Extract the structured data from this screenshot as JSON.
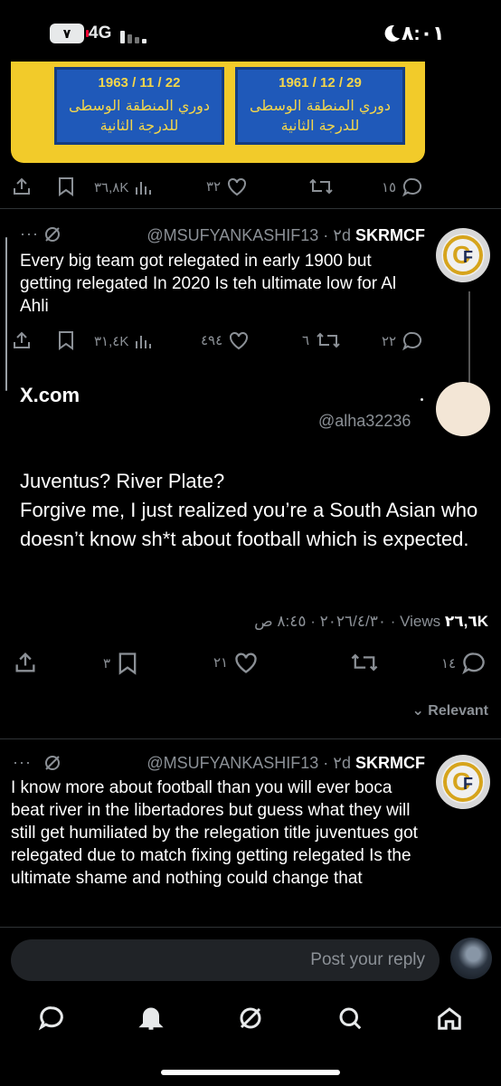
{
  "status": {
    "battery": "٧",
    "network": "4G",
    "time": "٨:٠١"
  },
  "media": {
    "plaques": [
      {
        "date": "1963 / 11 / 22",
        "line1": "دوري المنطقة الوسطى",
        "line2": "للدرجة الثانية"
      },
      {
        "date": "1961 / 12 / 29",
        "line1": "دوري المنطقة الوسطى",
        "line2": "للدرجة الثانية"
      }
    ]
  },
  "first_actions": {
    "views": "٣٦,٨K",
    "likes": "٣٢",
    "replies": "١٥"
  },
  "tweet1": {
    "name": "SKRMCF",
    "handle_time": "@MSUFYANKASHIF13 · ٢d",
    "body": "Every big team got relegated in early 1900 but getting relegated In 2020 Is teh ultimate low for Al Ahli",
    "views": "٣١,٤K",
    "likes": "٤٩٤",
    "retweets": "٦",
    "replies": "٢٢"
  },
  "main_tweet": {
    "source": "X.com",
    "handle": "@alha32236",
    "body_line1": "Juventus? River Plate?",
    "body_line2": "Forgive me, I just realized you’re a South Asian who doesn’t know sh*t about football which is expected.",
    "meta": "٢٠٢٦/٤/٣٠ · ٨:٤٥ ص · ",
    "views_count": "٢٦,٦K",
    "views_label": "Views",
    "bookmarks": "٣",
    "likes": "٢١",
    "replies": "١٤"
  },
  "sort": {
    "label": "Relevant"
  },
  "tweet2": {
    "name": "SKRMCF",
    "handle_time": "@MSUFYANKASHIF13 · ٢d",
    "body": "I know more about football than you will ever boca beat river in the libertadores  but guess what they will still get humiliated by the relegation title juventues got relegated due to match fixing getting relegated Is the ultimate shame and nothing could change that"
  },
  "reply": {
    "placeholder": "Post your reply"
  }
}
